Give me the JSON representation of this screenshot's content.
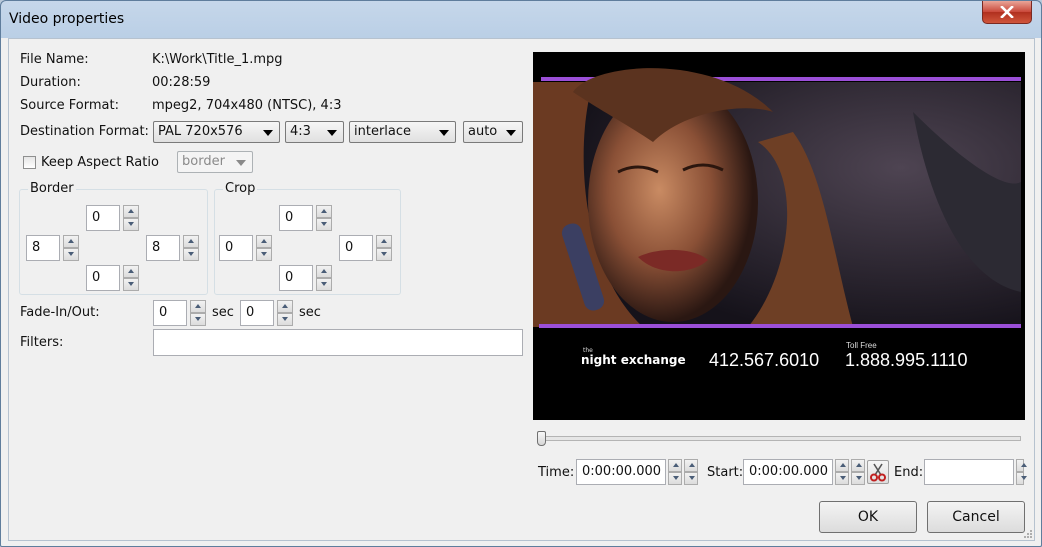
{
  "window": {
    "title": "Video properties"
  },
  "info": {
    "file_name_label": "File Name:",
    "file_name": "K:\\Work\\Title_1.mpg",
    "duration_label": "Duration:",
    "duration": "00:28:59",
    "source_format_label": "Source Format:",
    "source_format": "mpeg2, 704x480 (NTSC), 4:3",
    "destination_format_label": "Destination Format:",
    "destination": {
      "size": "PAL 720x576",
      "aspect": "4:3",
      "scan": "interlace",
      "mode": "auto"
    }
  },
  "keep_aspect": {
    "label": "Keep Aspect Ratio",
    "checked": false,
    "mode": "border"
  },
  "border": {
    "title": "Border",
    "top": "0",
    "left": "8",
    "right": "8",
    "bottom": "0"
  },
  "crop": {
    "title": "Crop",
    "top": "0",
    "left": "0",
    "right": "0",
    "bottom": "0"
  },
  "fade": {
    "label": "Fade-In/Out:",
    "in": "0",
    "out": "0",
    "unit": "sec"
  },
  "filters": {
    "label": "Filters:",
    "value": ""
  },
  "preview": {
    "brand": "night exchange",
    "brand_prefix": "the",
    "phone_local": "412.567.6010",
    "toll_free_label": "Toll Free",
    "phone_toll_free": "1.888.995.1110"
  },
  "timeline": {
    "position_fraction": 0.0,
    "time_label": "Time:",
    "time": "0:00:00.000",
    "start_label": "Start:",
    "start": "0:00:00.000",
    "end_label": "End:",
    "end": ""
  },
  "buttons": {
    "ok": "OK",
    "cancel": "Cancel"
  },
  "colors": {
    "accent_bar": "#9b4fd8",
    "close_red": "#c9483a"
  }
}
